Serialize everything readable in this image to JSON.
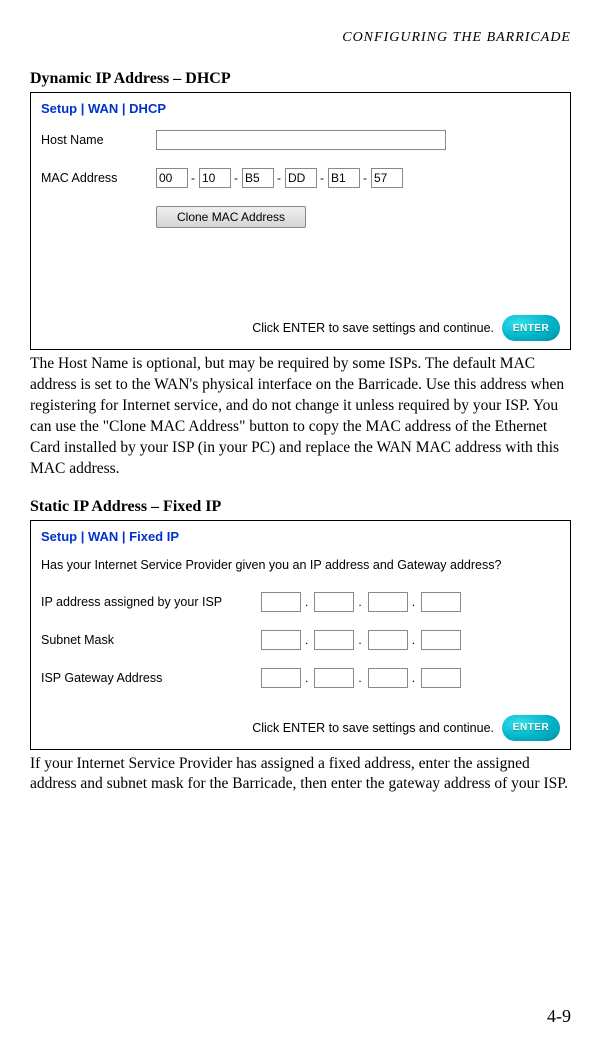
{
  "header": {
    "running_head": "CONFIGURING THE BARRICADE"
  },
  "section1": {
    "heading": "Dynamic IP Address – DHCP",
    "breadcrumb": "Setup | WAN | DHCP",
    "host_label": "Host Name",
    "host_value": "",
    "mac_label": "MAC Address",
    "mac": [
      "00",
      "10",
      "B5",
      "DD",
      "B1",
      "57"
    ],
    "mac_sep": "-",
    "clone_button": "Clone MAC Address",
    "enter_hint": "Click ENTER to save settings and continue.",
    "enter_label": "ENTER",
    "body": "The Host Name is optional, but may be required by some ISPs. The default MAC address is set to the WAN's physical interface on the Barricade. Use this address when registering for Internet service, and do not change it unless required by your ISP. You can use the \"Clone MAC Address\" button to copy the MAC address of the Ethernet Card installed by your ISP (in your PC) and replace the WAN MAC address with this MAC address."
  },
  "section2": {
    "heading": "Static IP Address – Fixed IP",
    "breadcrumb": "Setup | WAN | Fixed IP",
    "question": "Has your Internet Service Provider given you an IP address and Gateway address?",
    "ip_label": "IP address assigned by your ISP",
    "subnet_label": "Subnet Mask",
    "gateway_label": "ISP Gateway Address",
    "ip_sep": ".",
    "enter_hint": "Click ENTER to save settings and continue.",
    "enter_label": "ENTER",
    "body": "If your Internet Service Provider has assigned a fixed address, enter the assigned address and subnet mask for the Barricade, then enter the gateway address of your ISP."
  },
  "page_number": "4-9"
}
